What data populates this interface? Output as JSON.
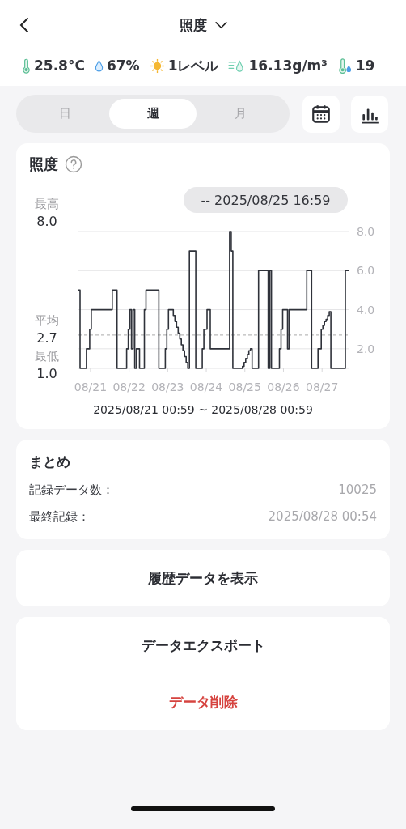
{
  "header": {
    "title": "照度"
  },
  "metrics": [
    {
      "kind": "temperature",
      "value": "25.8°C"
    },
    {
      "kind": "humidity",
      "value": "67%"
    },
    {
      "kind": "light",
      "value": "1レベル"
    },
    {
      "kind": "absolute_humidity",
      "value": "16.13g/m³"
    },
    {
      "kind": "dew_point",
      "value": "19"
    }
  ],
  "period_tabs": [
    {
      "label": "日",
      "selected": false
    },
    {
      "label": "週",
      "selected": true
    },
    {
      "label": "月",
      "selected": false
    }
  ],
  "chart_card": {
    "title": "照度",
    "tooltip": "-- 2025/08/25 16:59",
    "stats": [
      {
        "label": "最高",
        "value": "8.0"
      },
      {
        "label": "平均",
        "value": "2.7",
        "kind": "average"
      },
      {
        "label": "最低",
        "value": "1.0"
      }
    ],
    "range": "2025/08/21 00:59 ~ 2025/08/28 00:59",
    "chart_data": {
      "type": "line",
      "ylim": [
        1,
        8
      ],
      "categories": [
        null,
        null,
        null,
        null,
        null,
        null,
        null,
        "08/21",
        null,
        null,
        null,
        null,
        null,
        null,
        null,
        null,
        null,
        null,
        null,
        null,
        null,
        null,
        null,
        null,
        null,
        null,
        null,
        null,
        null,
        null,
        null,
        "08/22",
        null,
        null,
        null,
        null,
        null,
        null,
        null,
        null,
        null,
        null,
        null,
        null,
        null,
        null,
        null,
        null,
        null,
        null,
        null,
        null,
        null,
        null,
        null,
        "08/23",
        null,
        null,
        null,
        null,
        null,
        null,
        null,
        null,
        null,
        null,
        null,
        null,
        null,
        null,
        null,
        null,
        null,
        null,
        null,
        null,
        null,
        null,
        null,
        "08/24",
        null,
        null,
        null,
        null,
        null,
        null,
        null,
        null,
        null,
        null,
        null,
        null,
        null,
        null,
        null,
        null,
        null,
        null,
        null,
        null,
        null,
        null,
        null,
        "08/25",
        null,
        null,
        null,
        null,
        null,
        null,
        null,
        null,
        null,
        null,
        null,
        null,
        null,
        null,
        null,
        null,
        null,
        null,
        null,
        null,
        null,
        null,
        null,
        "08/26",
        null,
        null,
        null,
        null,
        null,
        null,
        null,
        null,
        null,
        null,
        null,
        null,
        null,
        null,
        null,
        null,
        null,
        null,
        null,
        null,
        null,
        null,
        null,
        "08/27",
        null,
        null,
        null,
        null,
        null,
        null,
        null,
        null,
        null,
        null,
        null,
        null,
        null,
        null,
        null,
        null
      ],
      "yticks": [
        {
          "value": 2,
          "label": "2.0"
        },
        {
          "value": 4,
          "label": "4.0"
        },
        {
          "value": 6,
          "label": "6.0"
        },
        {
          "value": 8,
          "label": "8.0"
        }
      ],
      "series": [
        {
          "color": "#2f323a",
          "values": [
            5,
            1,
            1,
            1,
            1,
            2,
            2,
            3,
            4,
            4,
            4,
            4,
            4,
            4,
            4,
            4,
            4,
            4,
            4,
            4,
            4,
            5,
            5,
            5,
            1,
            1,
            1,
            1,
            1,
            1,
            2,
            3,
            4,
            2,
            4,
            1,
            2,
            2,
            1,
            1,
            1,
            4,
            5,
            5,
            5,
            5,
            5,
            5,
            5,
            5,
            1,
            1,
            1,
            1,
            2,
            3,
            4,
            4,
            4,
            3.7,
            3.4,
            3.1,
            2.8,
            2.5,
            2.2,
            1.9,
            1.6,
            1.3,
            1,
            7,
            7,
            7,
            7,
            1,
            1,
            1,
            1,
            2,
            3,
            3,
            4,
            4,
            2,
            2,
            2,
            2,
            2,
            2,
            2,
            2,
            2,
            2,
            2,
            2,
            8,
            7,
            1,
            1,
            1,
            1,
            1,
            1,
            1.1,
            1.3,
            1.5,
            1.7,
            1.9,
            2,
            1,
            1,
            1,
            1,
            6,
            6,
            6,
            6,
            6,
            6,
            1,
            6,
            1,
            1,
            1,
            1,
            1,
            2,
            3,
            4,
            4,
            4,
            2,
            4,
            4,
            4,
            4,
            4,
            4,
            4,
            4,
            4,
            4,
            4,
            6,
            6,
            6,
            1,
            1,
            1,
            1,
            2,
            2,
            3,
            3.2,
            3.4,
            3.5,
            3.7,
            3.9,
            1,
            1,
            1,
            1,
            1,
            1,
            1,
            1,
            1,
            6,
            6
          ]
        }
      ],
      "grid": true,
      "ref_lines": [
        {
          "axis": "y",
          "value": 2.7
        }
      ]
    }
  },
  "summary": {
    "title": "まとめ",
    "rows": [
      {
        "label": "記録データ数：",
        "value": "10025"
      },
      {
        "label": "最終記録：",
        "value": "2025/08/28 00:54"
      }
    ]
  },
  "action_groups": [
    {
      "buttons": [
        {
          "label": "履歴データを表示",
          "kind": "normal"
        }
      ]
    },
    {
      "buttons": [
        {
          "label": "データエクスポート",
          "kind": "normal"
        },
        {
          "label": "データ削除",
          "kind": "danger"
        }
      ]
    }
  ]
}
